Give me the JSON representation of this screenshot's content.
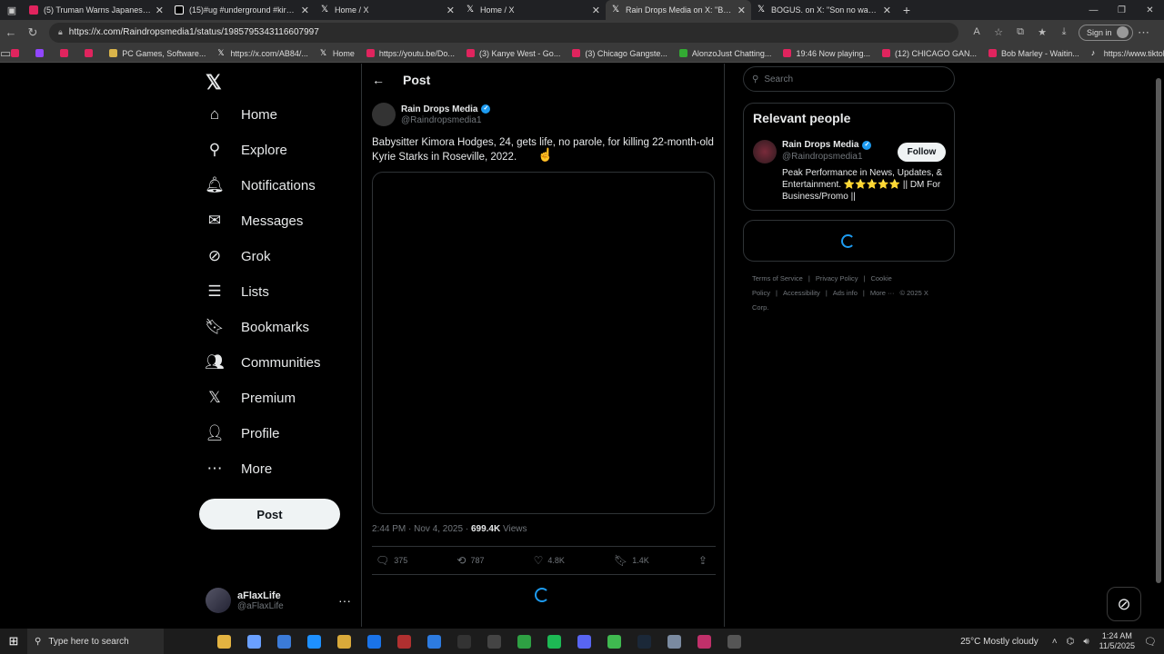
{
  "browser": {
    "tabs": [
      {
        "title": "(5) Truman Warns Japanese - 194",
        "icon": "youtube",
        "active": false
      },
      {
        "title": "(15)#ug #underground #kirkificat",
        "icon": "tiktok",
        "active": false
      },
      {
        "title": "Home / X",
        "icon": "x",
        "active": false
      },
      {
        "title": "Home / X",
        "icon": "x",
        "active": false
      },
      {
        "title": "Rain Drops Media on X: \"Babysitt",
        "icon": "x",
        "active": true
      },
      {
        "title": "BOGUS. on X: \"Son no way this sh",
        "icon": "x",
        "active": false
      }
    ],
    "url": "https://x.com/Raindropsmedia1/status/1985795343116607997",
    "signin_label": "Sign in",
    "bookmarks": [
      {
        "label": "",
        "icon": "youtube"
      },
      {
        "label": "",
        "icon": "twitch"
      },
      {
        "label": "",
        "icon": "youtube"
      },
      {
        "label": "",
        "icon": "youtube"
      },
      {
        "label": "PC Games, Software...",
        "icon": "folder"
      },
      {
        "label": "https://x.com/AB84/...",
        "icon": "x"
      },
      {
        "label": "Home",
        "icon": "x"
      },
      {
        "label": "https://youtu.be/Do...",
        "icon": "youtube"
      },
      {
        "label": "(3) Kanye West - Go...",
        "icon": "youtube"
      },
      {
        "label": "(3) Chicago Gangste...",
        "icon": "youtube"
      },
      {
        "label": "AlonzoJust Chatting...",
        "icon": "green"
      },
      {
        "label": "19:46 Now playing...",
        "icon": "youtube"
      },
      {
        "label": "(12) CHICAGO GAN...",
        "icon": "youtube"
      },
      {
        "label": "Bob Marley - Waitin...",
        "icon": "youtube"
      },
      {
        "label": "https://www.tiktok.c...",
        "icon": "tiktok"
      }
    ]
  },
  "nav": {
    "items": [
      {
        "label": "Home",
        "icon": "home-icon",
        "glyph": "⌂"
      },
      {
        "label": "Explore",
        "icon": "search-icon",
        "glyph": "⚲"
      },
      {
        "label": "Notifications",
        "icon": "bell-icon",
        "glyph": "🔔︎"
      },
      {
        "label": "Messages",
        "icon": "envelope-icon",
        "glyph": "✉"
      },
      {
        "label": "Grok",
        "icon": "grok-icon",
        "glyph": "⊘"
      },
      {
        "label": "Lists",
        "icon": "list-icon",
        "glyph": "☰"
      },
      {
        "label": "Bookmarks",
        "icon": "bookmark-icon",
        "glyph": "🔖︎"
      },
      {
        "label": "Communities",
        "icon": "communities-icon",
        "glyph": "👥︎"
      },
      {
        "label": "Premium",
        "icon": "x-logo-icon",
        "glyph": "𝕏"
      },
      {
        "label": "Profile",
        "icon": "person-icon",
        "glyph": "👤︎"
      },
      {
        "label": "More",
        "icon": "more-circle-icon",
        "glyph": "⋯"
      }
    ],
    "post_button": "Post",
    "account": {
      "name": "aFlaxLife",
      "handle": "@aFlaxLife"
    }
  },
  "post": {
    "header": "Post",
    "author_name": "Rain Drops Media",
    "author_handle": "@Raindropsmedia1",
    "text": "Babysitter Kimora Hodges, 24, gets life, no parole, for killing 22-month-old Kyrie Starks in Roseville, 2022.",
    "timestamp": "2:44 PM · Nov 4, 2025 · ",
    "views_count": "699.4K",
    "views_label": " Views",
    "replies": "375",
    "reposts": "787",
    "likes": "4.8K",
    "bookmarks": "1.4K"
  },
  "sidebar": {
    "search_placeholder": "Search",
    "relevant_title": "Relevant people",
    "person_name": "Rain Drops Media",
    "person_handle": "@Raindropsmedia1",
    "follow_label": "Follow",
    "bio": "Peak Performance in News, Updates, & Entertainment. ⭐⭐⭐⭐⭐ || DM For Business/Promo ||",
    "footer_links": [
      "Terms of Service",
      "|",
      "Privacy Policy",
      "|",
      "Cookie Policy",
      "|",
      "Accessibility",
      "|",
      "Ads info",
      "|",
      "More ···",
      "© 2025 X Corp."
    ]
  },
  "taskbar": {
    "search_placeholder": "Type here to search",
    "weather": "25°C  Mostly cloudy",
    "time": "1:24 AM",
    "date": "11/5/2025",
    "app_colors": [
      "#e3b341",
      "#6aa0ff",
      "#3b7bd8",
      "#1e90ff",
      "#d9a93a",
      "#1a73e8",
      "#b03030",
      "#2d7be0",
      "#333",
      "#444",
      "#2ea043",
      "#1db954",
      "#5865f2",
      "#3fb950",
      "#1b2838",
      "#7a8aa0",
      "#c0306a",
      "#555"
    ]
  },
  "colors": {
    "accent": "#1d9bf0",
    "background": "#000000",
    "border": "#2f3336"
  }
}
